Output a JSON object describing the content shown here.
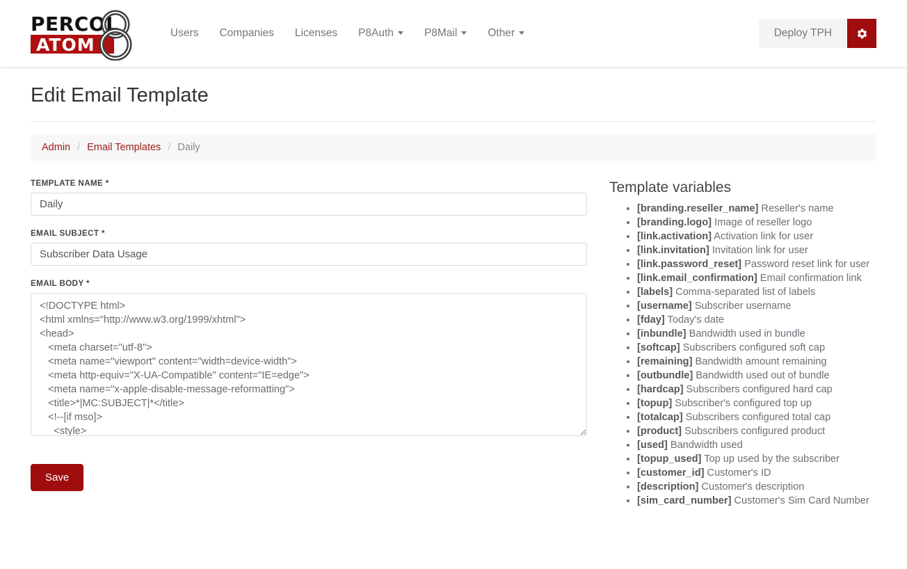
{
  "navbar": {
    "logo": {
      "top_text": "PERCOL",
      "bottom_text": "ATOM",
      "mark": "8"
    },
    "links": [
      {
        "label": "Users",
        "caret": false
      },
      {
        "label": "Companies",
        "caret": false
      },
      {
        "label": "Licenses",
        "caret": false
      },
      {
        "label": "P8Auth",
        "caret": true
      },
      {
        "label": "P8Mail",
        "caret": true
      },
      {
        "label": "Other",
        "caret": true
      }
    ],
    "deploy_label": "Deploy TPH",
    "settings_icon": "gear-icon"
  },
  "page": {
    "title": "Edit Email Template"
  },
  "breadcrumb": {
    "items": [
      {
        "label": "Admin",
        "link": true
      },
      {
        "label": "Email Templates",
        "link": true
      },
      {
        "label": "Daily",
        "link": false
      }
    ],
    "separator": "/"
  },
  "form": {
    "template_name": {
      "label": "TEMPLATE NAME *",
      "value": "Daily",
      "placeholder": ""
    },
    "email_subject": {
      "label": "EMAIL SUBJECT *",
      "value": "Subscriber Data Usage",
      "placeholder": ""
    },
    "email_body": {
      "label": "EMAIL BODY *",
      "value": "<!DOCTYPE html>\n<html xmlns=\"http://www.w3.org/1999/xhtml\">\n<head>\n   <meta charset=\"utf-8\">\n   <meta name=\"viewport\" content=\"width=device-width\">\n   <meta http-equiv=\"X-UA-Compatible\" content=\"IE=edge\">\n   <meta name=\"x-apple-disable-message-reformatting\">\n   <title>*|MC:SUBJECT|*</title>\n   <!--[if mso]>\n     <style>\n       table {border-collapse: collapse;}\n     </style>\n   <![endif]-->\n</head>\n<body>\n</body>\n</html>",
      "placeholder": ""
    },
    "save_label": "Save"
  },
  "variables_panel": {
    "title": "Template variables",
    "items": [
      {
        "key": "[branding.reseller_name]",
        "desc": "Reseller's name"
      },
      {
        "key": "[branding.logo]",
        "desc": "Image of reseller logo"
      },
      {
        "key": "[link.activation]",
        "desc": "Activation link for user"
      },
      {
        "key": "[link.invitation]",
        "desc": "Invitation link for user"
      },
      {
        "key": "[link.password_reset]",
        "desc": "Password reset link for user"
      },
      {
        "key": "[link.email_confirmation]",
        "desc": "Email confirmation link"
      },
      {
        "key": "[labels]",
        "desc": "Comma-separated list of labels"
      },
      {
        "key": "[username]",
        "desc": "Subscriber username"
      },
      {
        "key": "[fday]",
        "desc": "Today's date"
      },
      {
        "key": "[inbundle]",
        "desc": "Bandwidth used in bundle"
      },
      {
        "key": "[softcap]",
        "desc": "Subscribers configured soft cap"
      },
      {
        "key": "[remaining]",
        "desc": "Bandwidth amount remaining"
      },
      {
        "key": "[outbundle]",
        "desc": "Bandwidth used out of bundle"
      },
      {
        "key": "[hardcap]",
        "desc": "Subscribers configured hard cap"
      },
      {
        "key": "[topup]",
        "desc": "Subscriber's configured top up"
      },
      {
        "key": "[totalcap]",
        "desc": "Subscribers configured total cap"
      },
      {
        "key": "[product]",
        "desc": "Subscribers configured product"
      },
      {
        "key": "[used]",
        "desc": "Bandwidth used"
      },
      {
        "key": "[topup_used]",
        "desc": "Top up used by the subscriber"
      },
      {
        "key": "[customer_id]",
        "desc": "Customer's ID"
      },
      {
        "key": "[description]",
        "desc": "Customer's description"
      },
      {
        "key": "[sim_card_number]",
        "desc": "Customer's Sim Card Number"
      }
    ]
  },
  "colors": {
    "brand_red": "#b00f10",
    "button_red": "#a00d0e",
    "link_red": "#9b1b1b",
    "breadcrumb_bg": "#f7f7f7",
    "deploy_bg": "#f4f4f4"
  }
}
